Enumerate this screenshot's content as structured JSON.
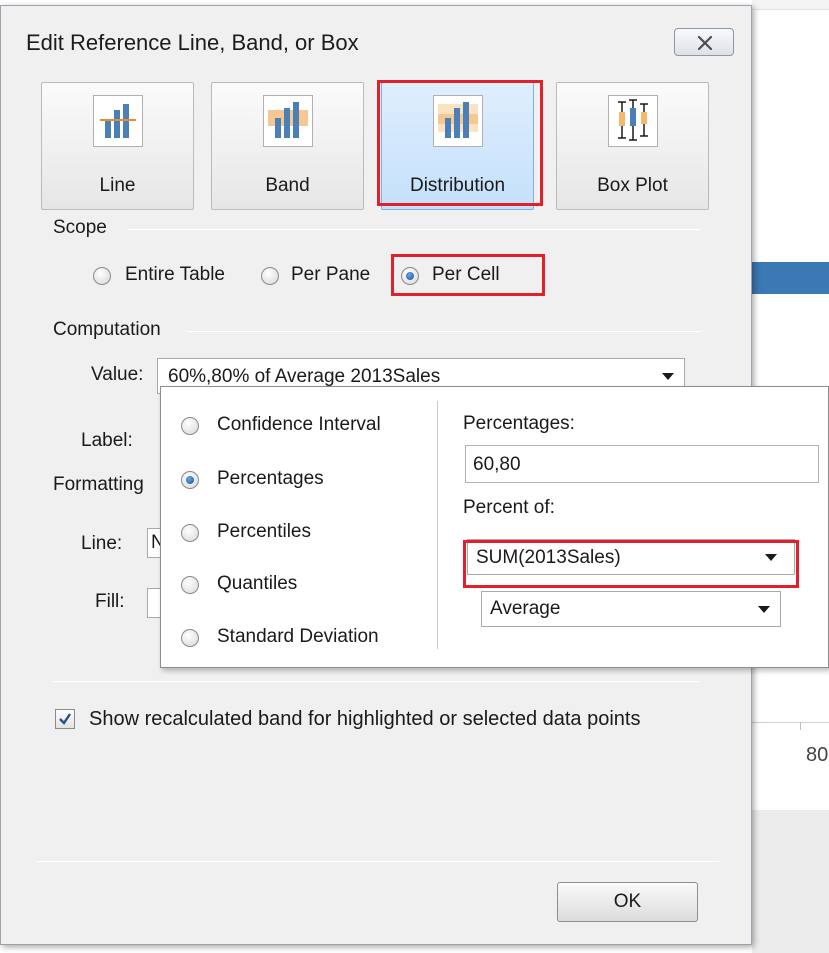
{
  "dialog": {
    "title": "Edit Reference Line, Band, or Box",
    "close_label": "✕"
  },
  "types": [
    {
      "label": "Line",
      "selected": false
    },
    {
      "label": "Band",
      "selected": false
    },
    {
      "label": "Distribution",
      "selected": true
    },
    {
      "label": "Box Plot",
      "selected": false
    }
  ],
  "scope": {
    "header": "Scope",
    "options": [
      {
        "label": "Entire Table",
        "selected": false
      },
      {
        "label": "Per Pane",
        "selected": false
      },
      {
        "label": "Per Cell",
        "selected": true
      }
    ]
  },
  "computation": {
    "header": "Computation",
    "value_label": "Value:",
    "value": "60%,80% of Average 2013Sales",
    "label_label": "Label:"
  },
  "formatting": {
    "header": "Formatting",
    "line_label": "Line:",
    "line_value_fragment": "N",
    "fill_label": "Fill:"
  },
  "popup": {
    "methods": [
      {
        "label": "Confidence Interval",
        "selected": false
      },
      {
        "label": "Percentages",
        "selected": true
      },
      {
        "label": "Percentiles",
        "selected": false
      },
      {
        "label": "Quantiles",
        "selected": false
      },
      {
        "label": "Standard Deviation",
        "selected": false
      }
    ],
    "percentages_label": "Percentages:",
    "percentages_value": "60,80",
    "percent_of_label": "Percent of:",
    "percent_of_value": "SUM(2013Sales)",
    "aggregation_value": "Average"
  },
  "show_recalculated": {
    "label": "Show recalculated band for highlighted or selected data points",
    "checked": true
  },
  "ok_label": "OK",
  "background": {
    "axis_tick_label": "80"
  },
  "colors": {
    "highlight": "#e0202a",
    "selected_button": "#c4e0fb",
    "bar_blue": "#3b78b4",
    "icon_orange": "#f5b96e",
    "icon_blue": "#4a7fb8"
  }
}
